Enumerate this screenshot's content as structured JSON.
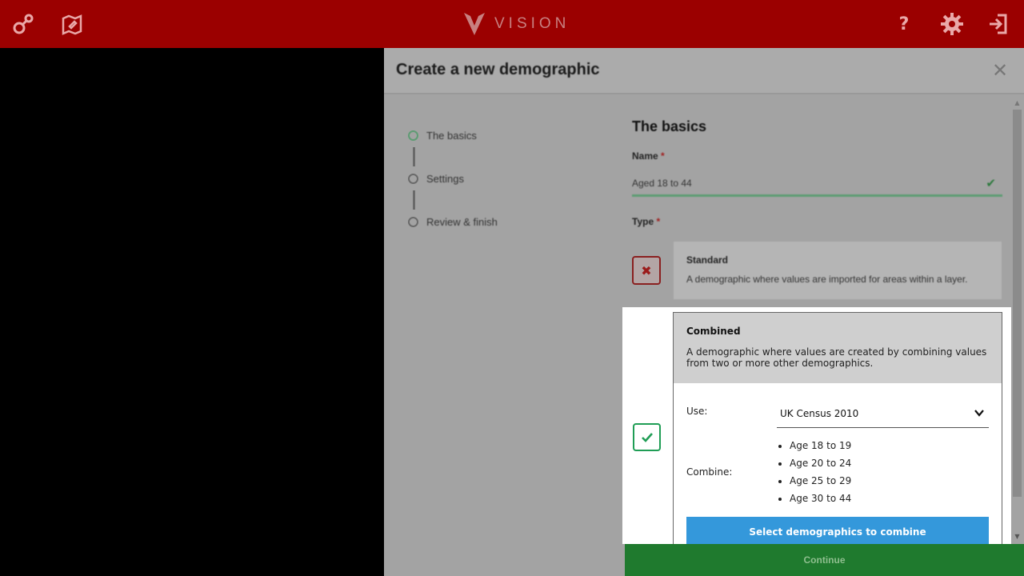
{
  "app": {
    "logo_text": "VISION"
  },
  "topbar": {
    "left_icons": [
      "connections-icon",
      "map-edit-icon"
    ],
    "right_icons": [
      "help-icon",
      "settings-icon",
      "logout-icon"
    ],
    "help_glyph": "?"
  },
  "modal": {
    "title": "Create a new demographic",
    "close_glyph": "✕"
  },
  "steps": [
    {
      "label": "The basics",
      "active": true
    },
    {
      "label": "Settings",
      "active": false
    },
    {
      "label": "Review & finish",
      "active": false
    }
  ],
  "form": {
    "section_title": "The basics",
    "name_label": "Name",
    "required_mark": "*",
    "name_value": "Aged 18 to 44",
    "type_label": "Type",
    "standard": {
      "title": "Standard",
      "description": "A demographic where values are imported for areas within a layer."
    },
    "combined": {
      "title": "Combined",
      "description": "A demographic where values are created by combining values from two or more other demographics.",
      "use_label": "Use:",
      "use_value": "UK Census 2010",
      "combine_label": "Combine:",
      "combine_items": [
        "Age 18 to 19",
        "Age 20 to 24",
        "Age 25 to 29",
        "Age 30 to 44"
      ],
      "select_button": "Select demographics to combine"
    }
  },
  "footer": {
    "continue_label": "Continue"
  },
  "colors": {
    "topbar": "#9b0000",
    "accent_green": "#1f9d55",
    "button_blue": "#3498db",
    "continue_green": "#1f7a2e"
  }
}
